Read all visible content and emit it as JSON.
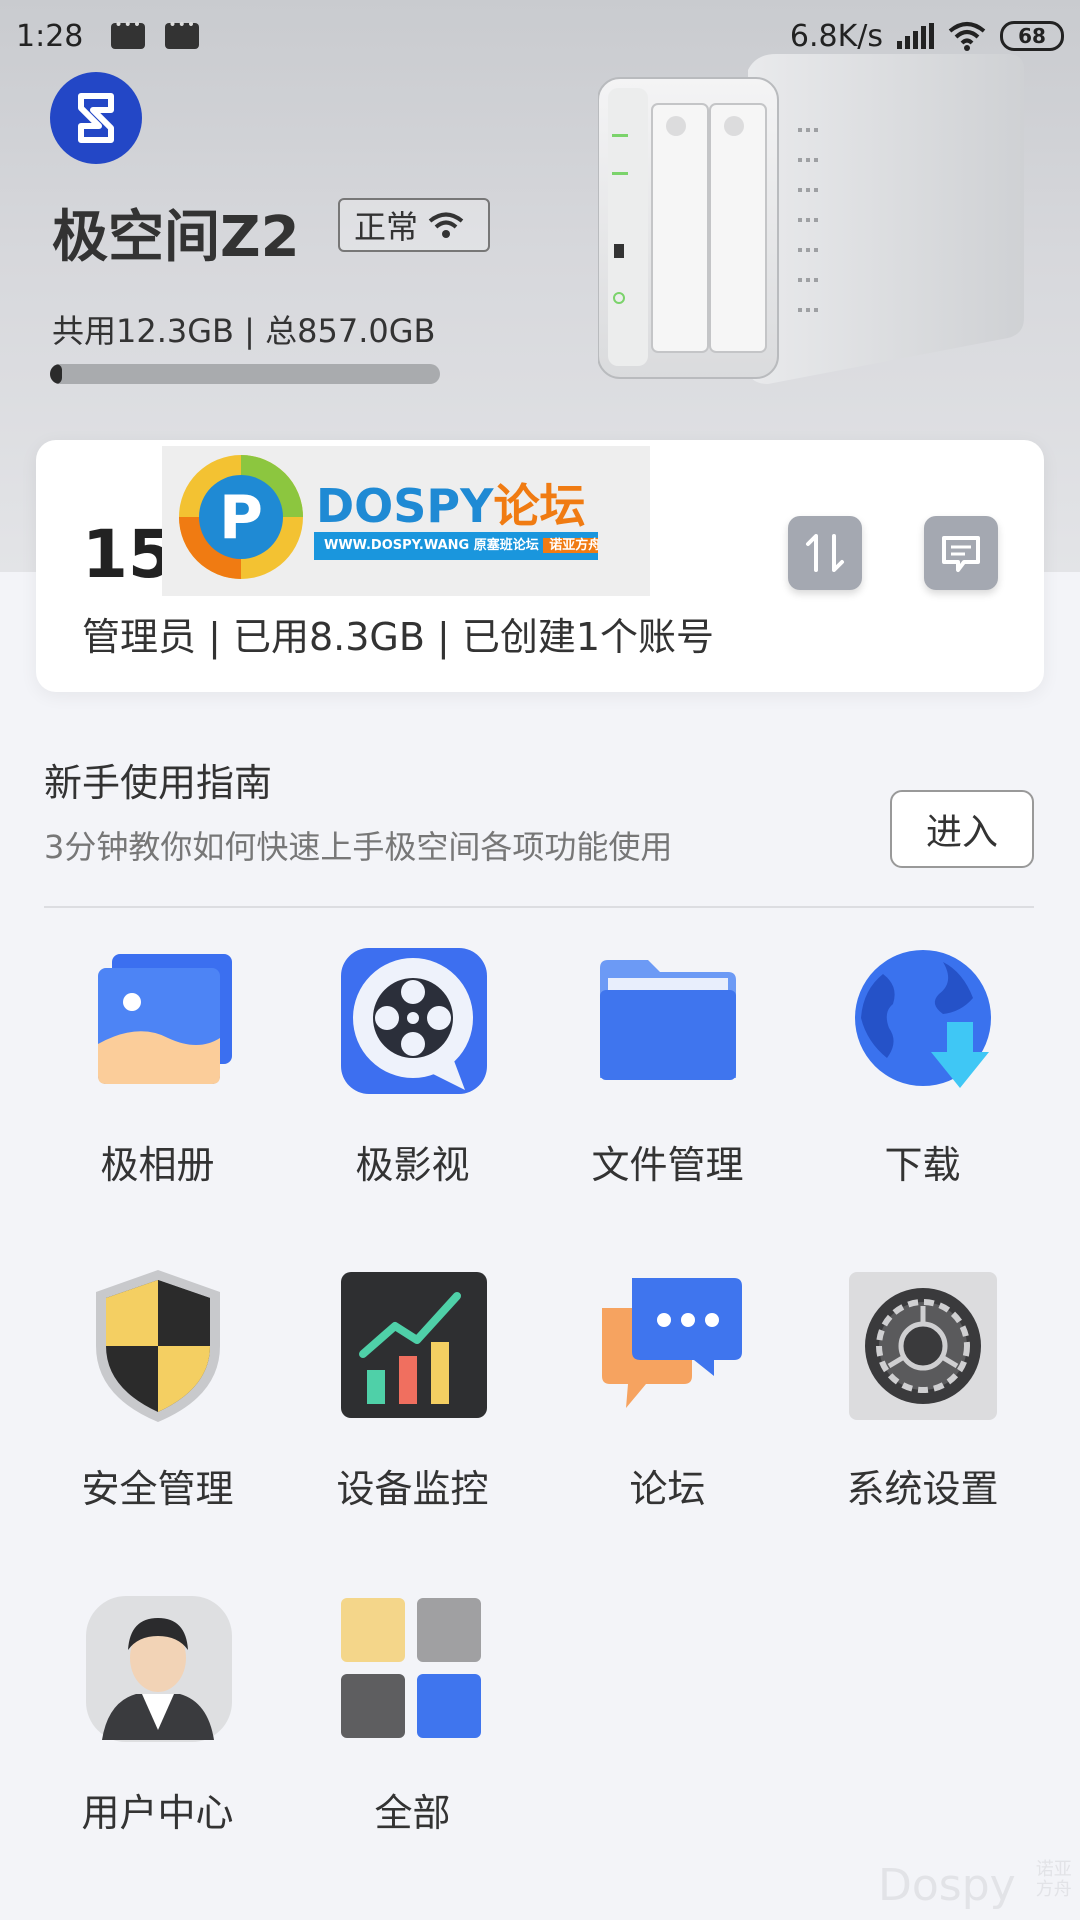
{
  "status_bar": {
    "time": "1:28",
    "network_speed": "6.8K/s",
    "battery": "68"
  },
  "device": {
    "name": "极空间Z2",
    "status_label": "正常",
    "storage_text": "共用12.3GB | 总857.0GB",
    "storage_used_fraction": 0.0144
  },
  "account_card": {
    "number": "15",
    "summary": "管理员 | 已用8.3GB | 已创建1个账号",
    "watermark_title": "DOSPY",
    "watermark_title_suffix": "论坛",
    "watermark_url": "WWW.DOSPY.WANG 原塞班论坛",
    "watermark_tag": "诺亚方舟号"
  },
  "guide": {
    "title": "新手使用指南",
    "subtitle": "3分钟教你如何快速上手极空间各项功能使用",
    "enter_label": "进入"
  },
  "apps": [
    {
      "label": "极相册",
      "icon": "photo-album-icon"
    },
    {
      "label": "极影视",
      "icon": "film-reel-icon"
    },
    {
      "label": "文件管理",
      "icon": "folder-icon"
    },
    {
      "label": "下载",
      "icon": "globe-download-icon"
    },
    {
      "label": "安全管理",
      "icon": "shield-icon"
    },
    {
      "label": "设备监控",
      "icon": "chart-monitor-icon"
    },
    {
      "label": "论坛",
      "icon": "chat-forum-icon"
    },
    {
      "label": "系统设置",
      "icon": "gear-icon"
    },
    {
      "label": "用户中心",
      "icon": "user-avatar-icon"
    },
    {
      "label": "全部",
      "icon": "grid-all-icon"
    }
  ],
  "corner_watermark": {
    "main": "Dospy",
    "line1": "诺亚",
    "line2": "方舟"
  },
  "colors": {
    "brand_blue": "#2347c6",
    "card_button_gray": "#a4a8b1",
    "page_background": "#f3f4f8"
  }
}
